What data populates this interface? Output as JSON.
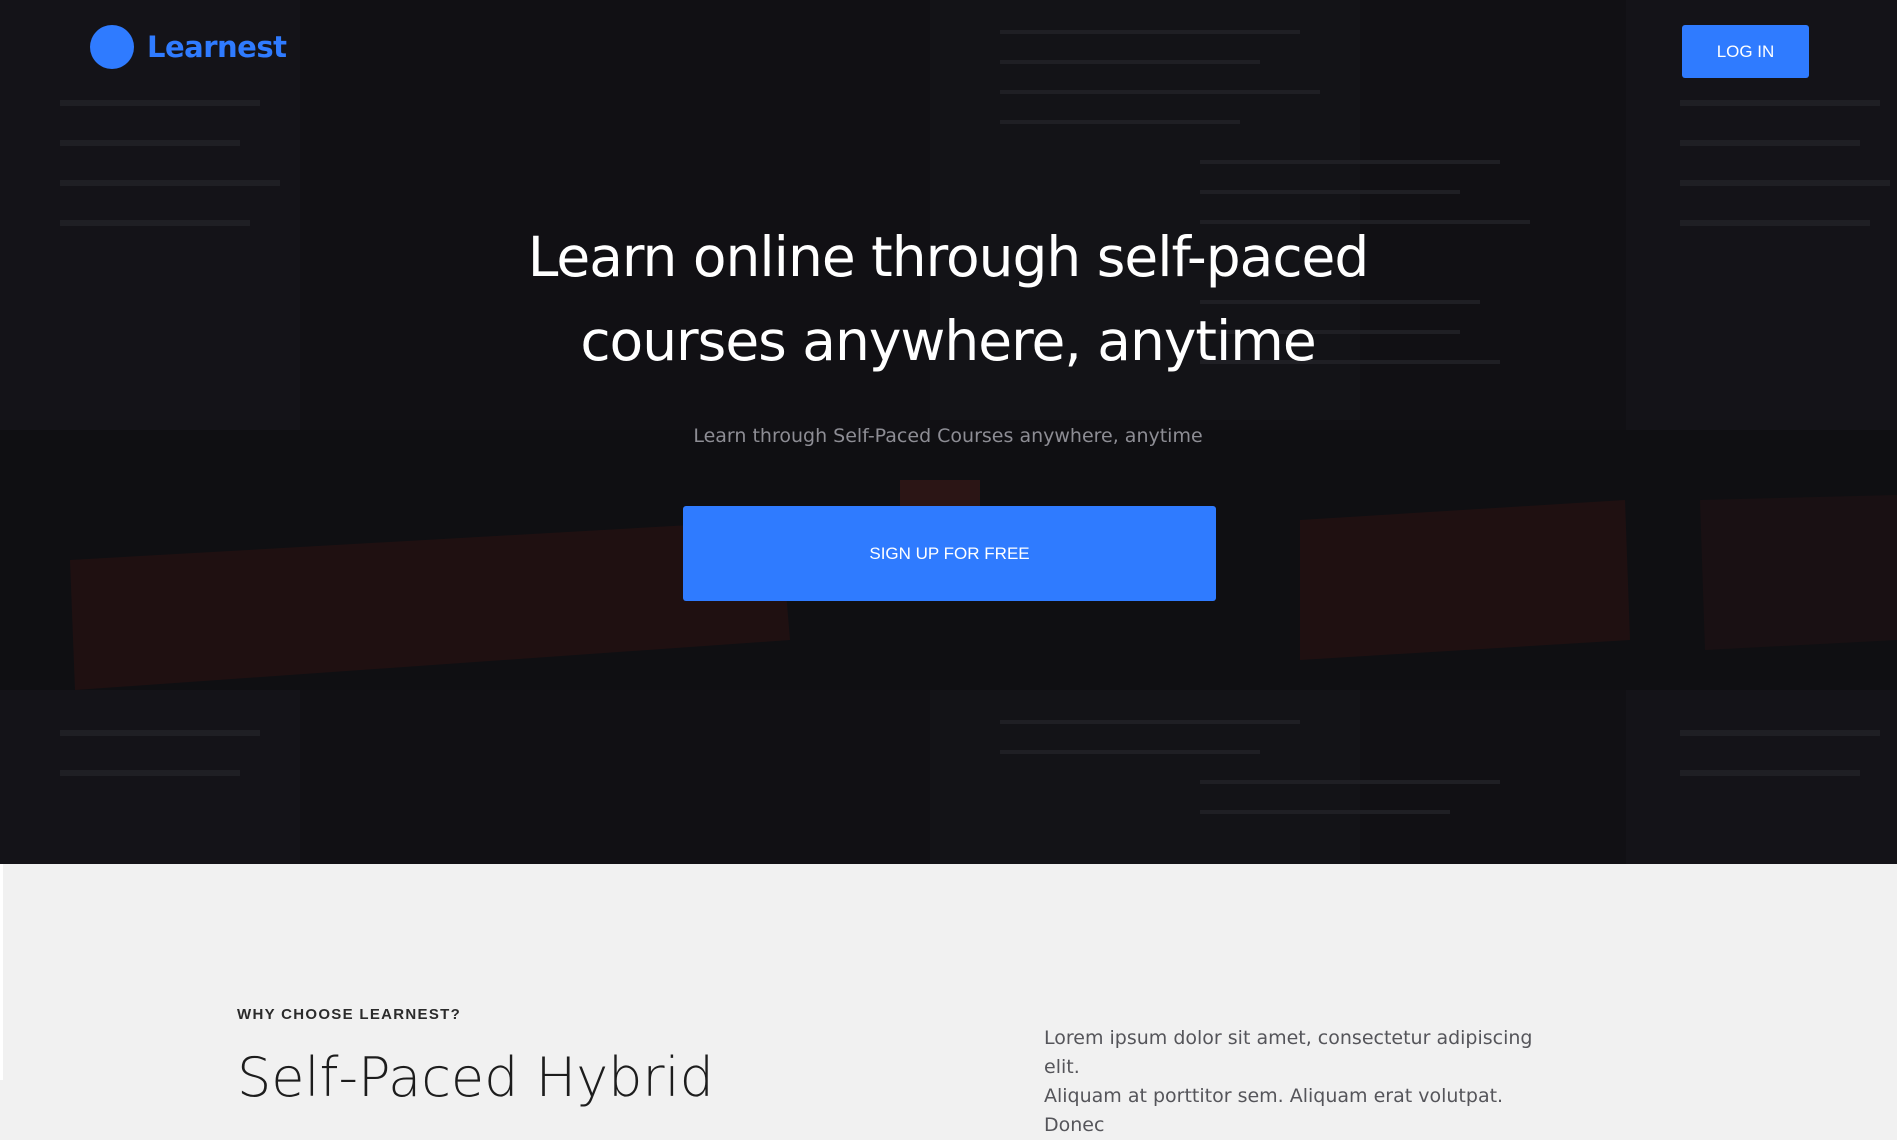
{
  "brand": {
    "name": "Learnest",
    "logo_icon": "circle-logo-icon",
    "color": "#2f7bff"
  },
  "header": {
    "login_label": "LOG IN"
  },
  "hero": {
    "title_line1": "Learn online through self-paced",
    "title_line2": "courses anywhere, anytime",
    "subtitle": "Learn through Self-Paced Courses anywhere, anytime",
    "cta_label": "SIGN UP FOR FREE",
    "background_color": "#17161b"
  },
  "why": {
    "eyebrow": "WHY CHOOSE LEARNEST?",
    "heading": "Self-Paced Hybrid",
    "body_line1": "Lorem ipsum dolor sit amet, consectetur adipiscing elit.",
    "body_line2": "Aliquam at porttitor sem. Aliquam erat volutpat. Donec",
    "background_color": "#f1f1f1"
  },
  "accent_color": "#2f7bff"
}
